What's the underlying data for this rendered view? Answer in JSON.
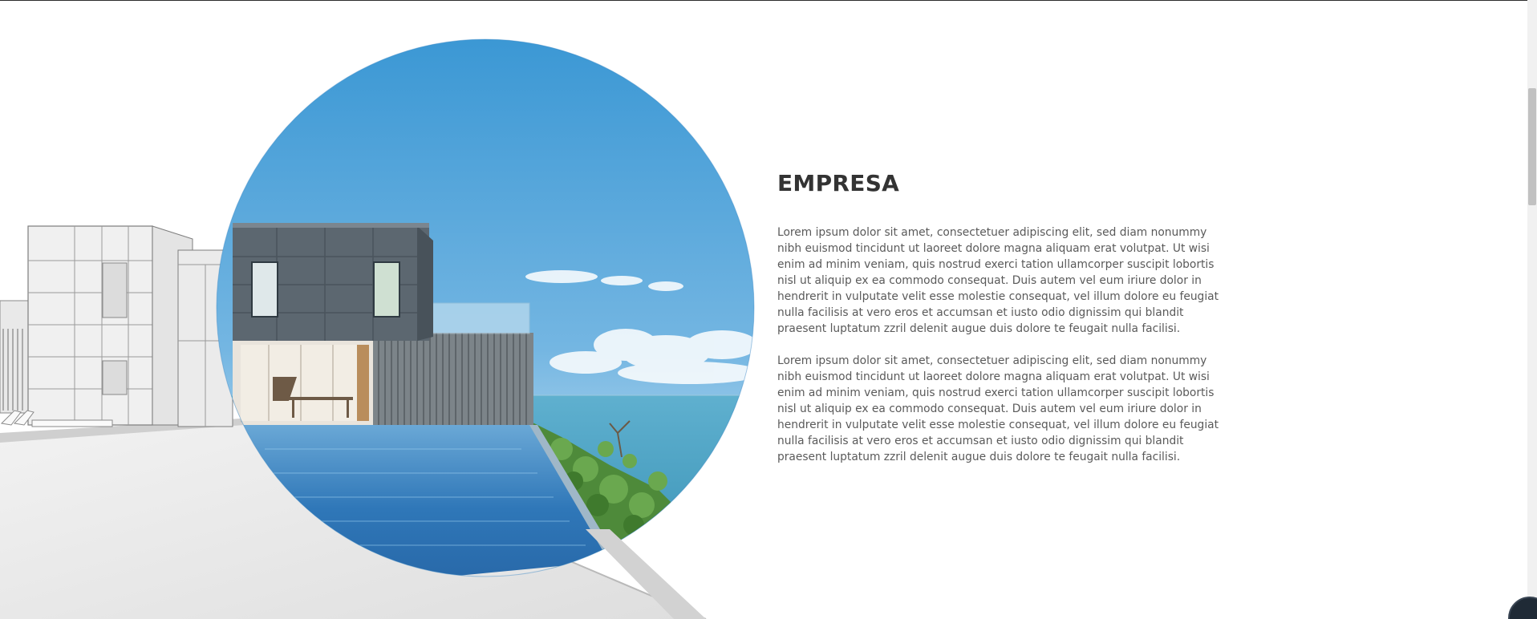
{
  "colors": {
    "title": "#333333",
    "body_text": "#5a5a5a",
    "sky_top": "#3a97d4",
    "sea": "#4aa3c5",
    "pool": "#2f77b8"
  },
  "icons": {
    "corner_widget": "chat-bubble-icon"
  },
  "section": {
    "title": "EMPRESA",
    "paragraphs": [
      "Lorem ipsum dolor sit amet, consectetuer adipiscing elit, sed diam nonummy nibh euismod tincidunt ut laoreet dolore magna aliquam erat volutpat. Ut wisi enim ad minim veniam, quis nostrud exerci tation ullamcorper suscipit lobortis nisl ut aliquip ex ea commodo consequat. Duis autem vel eum iriure dolor in hendrerit in vulputate velit esse molestie consequat, vel illum dolore eu feugiat nulla facilisis at vero eros et accumsan et iusto odio dignissim qui blandit praesent luptatum zzril delenit augue duis dolore te feugait nulla facilisi.",
      "Lorem ipsum dolor sit amet, consectetuer adipiscing elit, sed diam nonummy nibh euismod tincidunt ut laoreet dolore magna aliquam erat volutpat. Ut wisi enim ad minim veniam, quis nostrud exerci tation ullamcorper suscipit lobortis nisl ut aliquip ex ea commodo consequat. Duis autem vel eum iriure dolor in hendrerit in vulputate velit esse molestie consequat, vel illum dolore eu feugiat nulla facilisis at vero eros et accumsan et iusto odio dignissim qui blandit praesent luptatum zzril delenit augue duis dolore te feugait nulla facilisi."
    ]
  }
}
